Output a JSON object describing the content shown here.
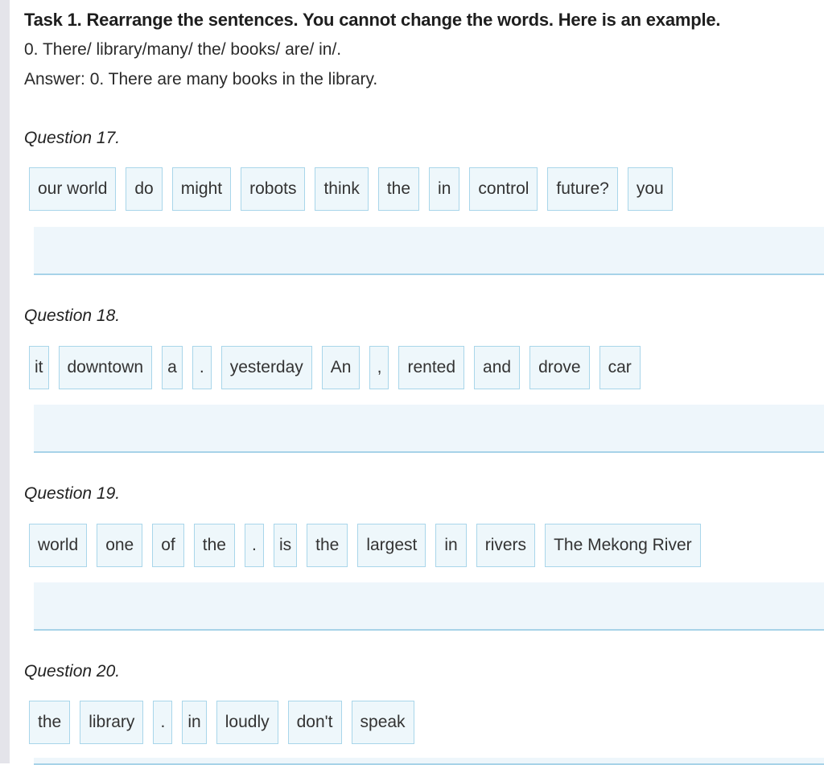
{
  "task": {
    "title": "Task 1. Rearrange the sentences. You cannot change the words. Here is an example.",
    "example": "0. There/ library/many/ the/ books/ are/ in/.",
    "answer": "Answer: 0. There are many books in the library."
  },
  "questions": [
    {
      "label": "Question 17.",
      "words": [
        "our world",
        "do",
        "might",
        "robots",
        "think",
        "the",
        "in",
        "control",
        "future?",
        "you"
      ]
    },
    {
      "label": "Question 18.",
      "words": [
        "it",
        "downtown",
        "a",
        ".",
        "yesterday",
        "An",
        ",",
        "rented",
        "and",
        "drove",
        "car"
      ]
    },
    {
      "label": "Question 19.",
      "words": [
        "world",
        "one",
        "of",
        "the",
        ".",
        "is",
        "the",
        "largest",
        "in",
        "rivers",
        "The Mekong River"
      ]
    },
    {
      "label": "Question 20.",
      "words": [
        "the",
        "library",
        ".",
        "in",
        "loudly",
        "don't",
        "speak"
      ]
    }
  ],
  "colors": {
    "tile_bg": "#eef7fb",
    "tile_border": "#a9d6ea",
    "answer_bg": "#eef6fb",
    "answer_border": "#a7d3e8"
  }
}
